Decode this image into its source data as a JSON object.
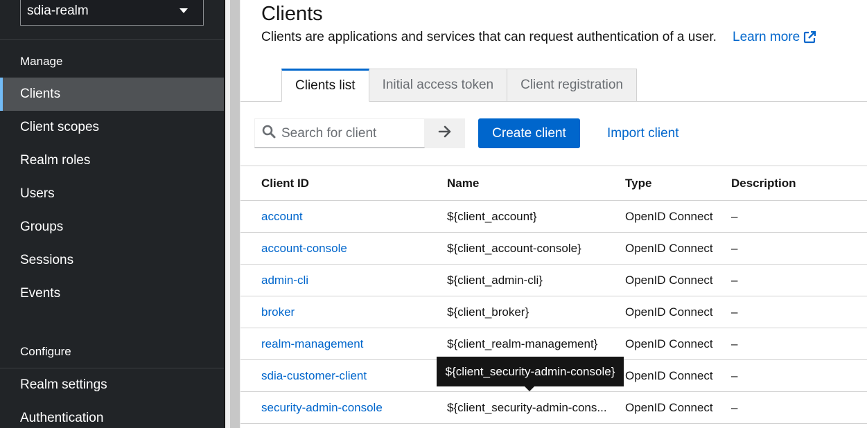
{
  "sidebar": {
    "realm": "sdia-realm",
    "sections": {
      "manage": "Manage",
      "configure": "Configure"
    },
    "manage_items": [
      {
        "label": "Clients",
        "active": true
      },
      {
        "label": "Client scopes"
      },
      {
        "label": "Realm roles"
      },
      {
        "label": "Users"
      },
      {
        "label": "Groups"
      },
      {
        "label": "Sessions"
      },
      {
        "label": "Events"
      }
    ],
    "configure_items": [
      {
        "label": "Realm settings"
      },
      {
        "label": "Authentication"
      }
    ]
  },
  "header": {
    "title": "Clients",
    "description": "Clients are applications and services that can request authentication of a user.",
    "learn_more": "Learn more"
  },
  "tabs": [
    {
      "label": "Clients list",
      "active": true
    },
    {
      "label": "Initial access token"
    },
    {
      "label": "Client registration"
    }
  ],
  "toolbar": {
    "search_placeholder": "Search for client",
    "create_label": "Create client",
    "import_label": "Import client"
  },
  "table": {
    "columns": [
      "Client ID",
      "Name",
      "Type",
      "Description"
    ],
    "rows": [
      {
        "client_id": "account",
        "name": "${client_account}",
        "type": "OpenID Connect",
        "description": "–"
      },
      {
        "client_id": "account-console",
        "name": "${client_account-console}",
        "type": "OpenID Connect",
        "description": "–"
      },
      {
        "client_id": "admin-cli",
        "name": "${client_admin-cli}",
        "type": "OpenID Connect",
        "description": "–"
      },
      {
        "client_id": "broker",
        "name": "${client_broker}",
        "type": "OpenID Connect",
        "description": "–"
      },
      {
        "client_id": "realm-management",
        "name": "${client_realm-management}",
        "type": "OpenID Connect",
        "description": "–"
      },
      {
        "client_id": "sdia-customer-client",
        "name": "",
        "type": "OpenID Connect",
        "description": "–"
      },
      {
        "client_id": "security-admin-console",
        "name": "${client_security-admin-cons...",
        "type": "OpenID Connect",
        "description": "–"
      }
    ]
  },
  "tooltip": "${client_security-admin-console}",
  "colors": {
    "sidebar_bg": "#212427",
    "active_nav_bg": "#4f5255",
    "active_indicator": "#73bcf7",
    "primary": "#0066cc"
  }
}
